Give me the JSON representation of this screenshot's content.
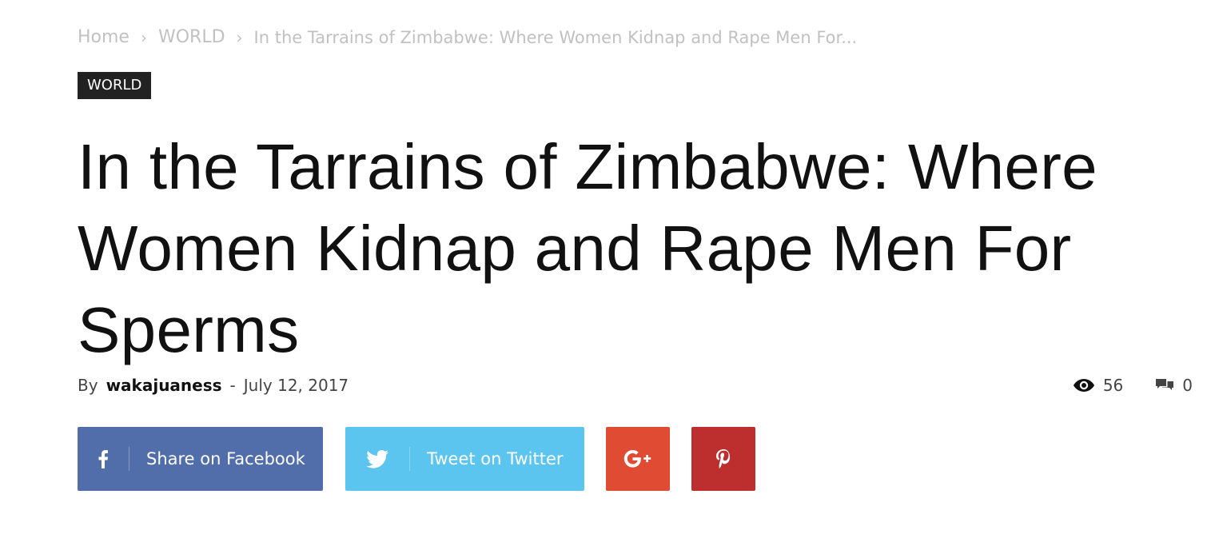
{
  "breadcrumb": {
    "home": "Home",
    "section": "WORLD",
    "current": "In the Tarrains of Zimbabwe: Where Women Kidnap and Rape Men For...",
    "separator": "›"
  },
  "category": "WORLD",
  "article": {
    "title": "In the Tarrains of Zimbabwe: Where Women Kidnap and Rape Men For Sperms",
    "by_label": "By",
    "author": "wakajuaness",
    "dash": "-",
    "date": "July 12, 2017",
    "views": "56",
    "comments": "0"
  },
  "share": {
    "facebook_label": "Share on Facebook",
    "twitter_label": "Tweet on Twitter",
    "google_icon": "google-plus-icon",
    "pinterest_icon": "pinterest-icon"
  },
  "colors": {
    "facebook": "#516eab",
    "twitter": "#5bc5ef",
    "google": "#e04b34",
    "pinterest": "#bd2f2f",
    "tag_bg": "#222222"
  }
}
